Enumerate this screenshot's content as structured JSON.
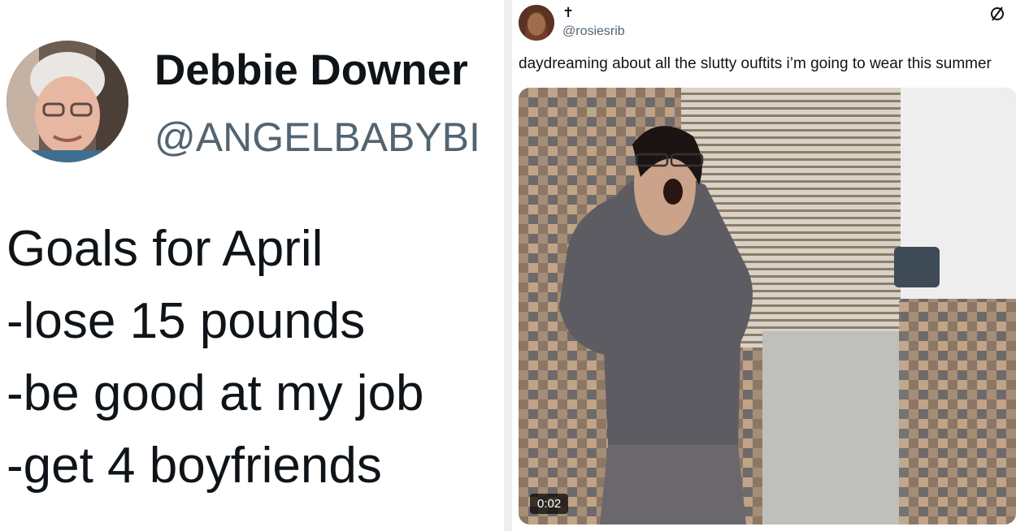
{
  "left_tweet": {
    "display_name": "Debbie Downer",
    "handle": "@ANGELBABYBI",
    "lines": [
      "Goals for April",
      "-lose 15 pounds",
      "-be good at my job",
      "-get 4 boyfriends"
    ]
  },
  "right_tweet": {
    "display_name": "✝",
    "handle": "@rosiesrib",
    "text": "daydreaming about all the slutty ouftits i’m going to wear this summer",
    "video_duration": "0:02"
  },
  "icons": {
    "more": "circle-slash-icon",
    "avatar_left": "avatar",
    "avatar_right": "avatar"
  },
  "colors": {
    "handle_gray": "#536471",
    "text_dark": "#0f1419",
    "divider": "#eceef0"
  }
}
